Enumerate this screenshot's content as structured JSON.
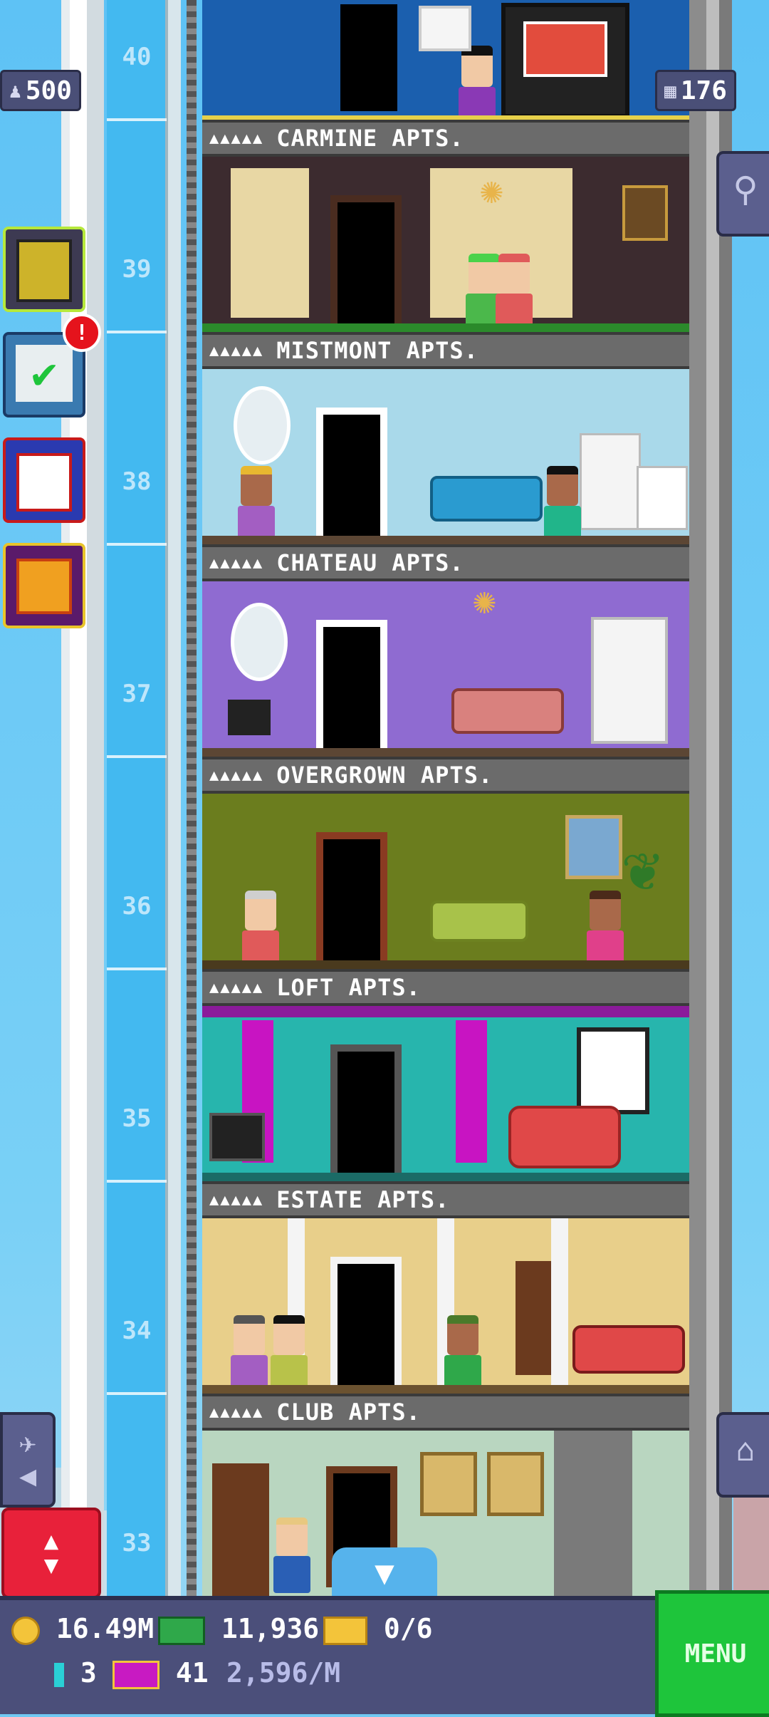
{
  "top": {
    "population": "500",
    "floors": "176"
  },
  "notifications": {
    "missions_badge": "!"
  },
  "floor_numbers": [
    "40",
    "39",
    "38",
    "37",
    "36",
    "35",
    "34",
    "33"
  ],
  "floors": [
    {
      "name": "CARMINE APTS.",
      "stars": "▲▲▲▲▲"
    },
    {
      "name": "MISTMONT APTS.",
      "stars": "▲▲▲▲▲"
    },
    {
      "name": "CHATEAU APTS.",
      "stars": "▲▲▲▲▲"
    },
    {
      "name": "OVERGROWN APTS.",
      "stars": "▲▲▲▲▲"
    },
    {
      "name": "LOFT APTS.",
      "stars": "▲▲▲▲▲"
    },
    {
      "name": "ESTATE APTS.",
      "stars": "▲▲▲▲▲"
    },
    {
      "name": "CLUB APTS.",
      "stars": "▲▲▲▲▲"
    }
  ],
  "hud": {
    "coins": "16.49M",
    "bux": "11,936",
    "tickets": "0/6",
    "keys": "3",
    "vip": "41",
    "income": "2,596/M",
    "menu_label": "MENU"
  },
  "colors": {
    "sky": "#5ec2f5",
    "menu_green": "#1ec53b",
    "elevator_red": "#e8213a",
    "hud_bg": "#4b4f7a"
  },
  "icons": [
    "population-icon",
    "floors-icon",
    "magnifier-icon",
    "calculator-icon",
    "missions-icon",
    "calendar-icon",
    "gift-icon",
    "home-icon",
    "elevator-icon",
    "down-arrow-icon",
    "coin-icon",
    "bux-icon",
    "ticket-icon",
    "key-icon",
    "vip-icon"
  ]
}
